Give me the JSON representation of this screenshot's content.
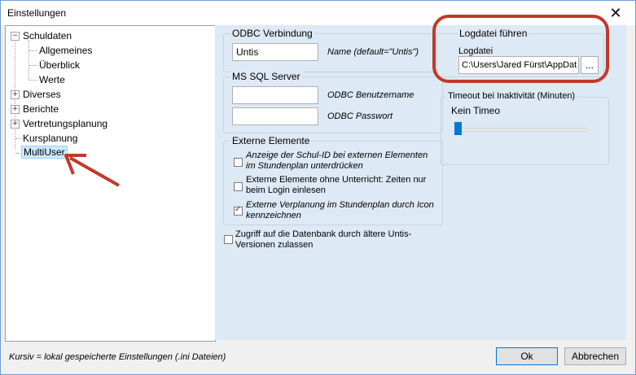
{
  "window": {
    "title": "Einstellungen",
    "close_glyph": "✕"
  },
  "tree": {
    "items": [
      {
        "label": "Schuldaten",
        "expander": "−"
      },
      {
        "label": "Allgemeines"
      },
      {
        "label": "Überblick"
      },
      {
        "label": "Werte"
      },
      {
        "label": "Diverses",
        "expander": "+"
      },
      {
        "label": "Berichte",
        "expander": "+"
      },
      {
        "label": "Vertretungsplanung",
        "expander": "+"
      },
      {
        "label": "Kursplanung"
      },
      {
        "label": "MultiUser"
      }
    ]
  },
  "odbc": {
    "title": "ODBC Verbindung",
    "name_value": "Untis",
    "name_label": "Name (default=\"Untis\")"
  },
  "mssql": {
    "title": "MS SQL Server",
    "user_value": "",
    "user_label": "ODBC Benutzername",
    "pass_value": "",
    "pass_label": "ODBC Passwort"
  },
  "extern": {
    "title": "Externe Elemente",
    "cb1": "Anzeige der Schul-ID bei externen Elementen im Stundenplan unterdrücken",
    "cb2": "Externe Elemente ohne Unterricht: Zeiten nur beim Login einlesen",
    "cb3": "Externe Verplanung im Stundenplan durch Icon kennzeichnen",
    "cb1_checked": false,
    "cb2_checked": false,
    "cb3_checked": true
  },
  "db_access": {
    "label": "Zugriff auf die Datenbank durch ältere Untis-Versionen zulassen",
    "checked": false
  },
  "logfile": {
    "title": "Logdatei führen",
    "field_label": "Logdatei",
    "path": "C:\\Users\\Jared Fürst\\AppDat",
    "browse": "..."
  },
  "timeout": {
    "title": "Timeout bei Inaktivität (Minuten)",
    "value_label": "Kein Timeo",
    "level": 0
  },
  "footer": {
    "note": "Kursiv = lokal gespeicherte Einstellungen (.ini Dateien)",
    "ok": "Ok",
    "cancel": "Abbrechen"
  },
  "colors": {
    "annotation": "#c0392b",
    "accent": "#0078d7"
  }
}
